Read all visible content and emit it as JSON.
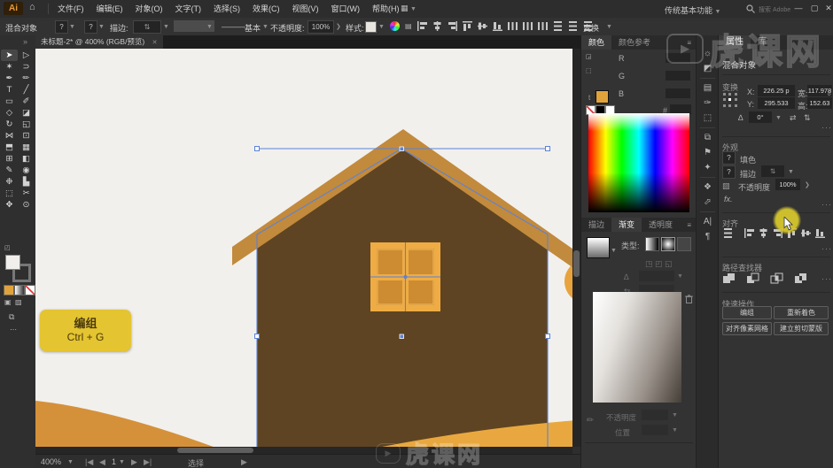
{
  "titlebar": {
    "logo": "Ai",
    "home_icon": "⌂",
    "menus": [
      "文件(F)",
      "编辑(E)",
      "对象(O)",
      "文字(T)",
      "选择(S)",
      "效果(C)",
      "视图(V)",
      "窗口(W)",
      "帮助(H)"
    ],
    "workspace_switcher_icon": "▦",
    "workspace": "传统基本功能",
    "search_hint": "搜索 Adobe Stock",
    "window_min": "—",
    "window_max": "▢",
    "window_close": "✕"
  },
  "options_bar": {
    "context": "混合对象",
    "fill_value": "?",
    "stroke_value": "?",
    "stroke_label": "描边:",
    "stroke_line": "———",
    "stroke_style": "基本",
    "opacity_label": "不透明度:",
    "opacity_value": "100%",
    "more_arrow": "❯",
    "style_label": "样式:",
    "transform_label": "变换"
  },
  "doc_tab": {
    "title": "未标题-2* @ 400% (RGB/预览)",
    "close": "✕"
  },
  "toolbar": {
    "overflow": "»",
    "ellipsis": "⋯",
    "tools": [
      {
        "name": "selection-tool",
        "glyph": "➤",
        "active": true
      },
      {
        "name": "direct-selection-tool",
        "glyph": "▷"
      },
      {
        "name": "magic-wand-tool",
        "glyph": "✶"
      },
      {
        "name": "lasso-tool",
        "glyph": "⊃"
      },
      {
        "name": "pen-tool",
        "glyph": "✒"
      },
      {
        "name": "curvature-tool",
        "glyph": "✏"
      },
      {
        "name": "type-tool",
        "glyph": "T"
      },
      {
        "name": "line-segment-tool",
        "glyph": "╱"
      },
      {
        "name": "rectangle-tool",
        "glyph": "▭"
      },
      {
        "name": "paintbrush-tool",
        "glyph": "✐"
      },
      {
        "name": "shaper-tool",
        "glyph": "◇"
      },
      {
        "name": "eraser-tool",
        "glyph": "◪"
      },
      {
        "name": "rotate-tool",
        "glyph": "↻"
      },
      {
        "name": "scale-tool",
        "glyph": "◱"
      },
      {
        "name": "width-tool",
        "glyph": "⋈"
      },
      {
        "name": "free-transform-tool",
        "glyph": "⊡"
      },
      {
        "name": "shape-builder-tool",
        "glyph": "⬒"
      },
      {
        "name": "perspective-grid-tool",
        "glyph": "▦"
      },
      {
        "name": "mesh-tool",
        "glyph": "⊞"
      },
      {
        "name": "gradient-tool",
        "glyph": "◧"
      },
      {
        "name": "eyedropper-tool",
        "glyph": "✎"
      },
      {
        "name": "blend-tool",
        "glyph": "◉"
      },
      {
        "name": "symbol-sprayer-tool",
        "glyph": "❉"
      },
      {
        "name": "column-graph-tool",
        "glyph": "▙"
      },
      {
        "name": "artboard-tool",
        "glyph": "⬚"
      },
      {
        "name": "slice-tool",
        "glyph": "✂"
      },
      {
        "name": "hand-tool",
        "glyph": "✥"
      },
      {
        "name": "zoom-tool",
        "glyph": "⊙"
      }
    ]
  },
  "canvas": {
    "artboard_color": "#f2f0ed",
    "house_color": "#5e4423",
    "roof_color": "#c28a3c",
    "window_frame_color": "#efac44",
    "window_pane_color": "#cd8c31",
    "hill_left_color": "#d5913a",
    "hill_right_color": "#e9a83f",
    "sun_color": "#e8a33d",
    "selection_color": "#5b82d8",
    "tooltip": {
      "title": "编组",
      "shortcut": "Ctrl + G",
      "bg": "#e4c431"
    }
  },
  "color_panel": {
    "tabs": [
      {
        "label": "颜色",
        "active": true
      },
      {
        "label": "颜色参考",
        "active": false
      }
    ],
    "channels": [
      "R",
      "G",
      "B"
    ],
    "fill_prefix": "t",
    "hex_label": "#"
  },
  "gradient_panel": {
    "tabs": [
      {
        "label": "描边",
        "active": false
      },
      {
        "label": "渐变",
        "active": true
      },
      {
        "label": "透明度",
        "active": false
      }
    ],
    "type_label": "类型:",
    "opacity_label": "不透明度",
    "location_label": "位置"
  },
  "dock": {
    "icons": [
      {
        "name": "swatches-panel-icon",
        "glyph": "☼"
      },
      {
        "name": "color-guide-panel-icon",
        "glyph": "◩"
      },
      {
        "name": "symbols-panel-icon",
        "glyph": "▤"
      },
      {
        "name": "brushes-panel-icon",
        "glyph": "✑"
      },
      {
        "name": "artboards-panel-icon",
        "glyph": "⬚"
      },
      {
        "name": "layers-panel-icon",
        "glyph": "⧉"
      },
      {
        "name": "align-panel-icon",
        "glyph": "⚑"
      },
      {
        "name": "magic-wand-panel-icon",
        "glyph": "✦"
      },
      {
        "name": "appearance-panel-icon",
        "glyph": "❖"
      },
      {
        "name": "export-panel-icon",
        "glyph": "⬀"
      },
      {
        "name": "character-panel-icon",
        "glyph": "A|"
      },
      {
        "name": "paragraph-panel-icon",
        "glyph": "¶"
      }
    ]
  },
  "properties": {
    "tabs": [
      {
        "label": "属性",
        "active": true
      },
      {
        "label": "库",
        "active": false
      }
    ],
    "object_type": "混合对象",
    "transform": {
      "title": "变换",
      "x_label": "X:",
      "x_value": "226.25 p",
      "w_label": "宽:",
      "w_value": "117.978",
      "y_label": "Y:",
      "y_value": "295.533",
      "h_label": "高:",
      "h_value": "152.63 p",
      "angle_value": "0°"
    },
    "appearance": {
      "title": "外观",
      "fill_value": "?",
      "fill_label": "填色",
      "stroke_value": "?",
      "stroke_label": "描边",
      "opacity_label": "不透明度",
      "opacity_value": "100%",
      "fx": "fx."
    },
    "align_title": "对齐",
    "pathfinder_title": "路径查找器",
    "quick_actions": {
      "title": "快速操作",
      "buttons": [
        "编组",
        "重新着色",
        "对齐像素网格",
        "建立剪切蒙版"
      ]
    },
    "more": "···"
  },
  "status_bar": {
    "zoom": "400%",
    "artboard": "1",
    "status": "选择"
  },
  "watermark": {
    "text": "虎课网"
  }
}
